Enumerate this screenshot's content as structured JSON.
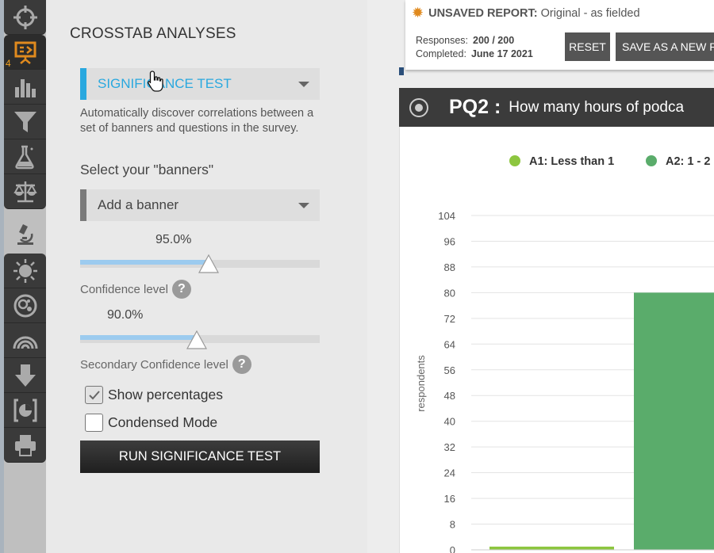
{
  "toolbar": {
    "items": [
      {
        "name": "target",
        "icon": "crosshair-icon"
      },
      {
        "name": "presentation",
        "icon": "presentation-icon",
        "badge": "4"
      },
      {
        "name": "charts",
        "icon": "bar-chart-icon"
      },
      {
        "name": "filter",
        "icon": "funnel-icon"
      },
      {
        "name": "lab",
        "icon": "flask-icon"
      },
      {
        "name": "weighting",
        "icon": "scales-icon"
      },
      {
        "name": "analysis",
        "icon": "microscope-icon"
      },
      {
        "name": "sun",
        "icon": "sun-icon"
      },
      {
        "name": "bubbles",
        "icon": "bubbles-icon"
      },
      {
        "name": "rainbow",
        "icon": "rainbow-icon"
      },
      {
        "name": "download",
        "icon": "download-arrow-icon"
      },
      {
        "name": "pie-export",
        "icon": "pie-bracket-icon"
      },
      {
        "name": "print",
        "icon": "printer-icon"
      }
    ]
  },
  "panel": {
    "title": "CROSSTAB ANALYSES",
    "analysis_select": "SIGNIFICANCE TEST",
    "description": "Automatically discover correlations between a set of banners and questions in the survey.",
    "banners_heading": "Select your \"banners\"",
    "banner_select": "Add a banner",
    "confidence": {
      "value": "95.0%",
      "fraction": 0.95,
      "label": "Confidence level"
    },
    "secondary_confidence": {
      "value": "90.0%",
      "fraction": 0.9,
      "label": "Secondary Confidence level"
    },
    "show_percentages": {
      "label": "Show percentages",
      "checked": true
    },
    "condensed_mode": {
      "label": "Condensed Mode",
      "checked": false
    },
    "run_button": "RUN SIGNIFICANCE TEST"
  },
  "report": {
    "status_label": "UNSAVED REPORT:",
    "status_value": "Original - as fielded",
    "responses_label": "Responses:",
    "responses_value": "200 / 200",
    "completed_label": "Completed:",
    "completed_value": "June 17 2021",
    "reset_button": "RESET",
    "save_as_button": "SAVE AS A NEW R"
  },
  "question": {
    "id": "PQ2 :",
    "text": "How many hours of podca"
  },
  "colors": {
    "accent": "#29a8df",
    "series_a1": "#8dc63f",
    "series_a2": "#5aac6b",
    "header_dark": "#3b3b3b",
    "orange": "#e08a1e"
  },
  "chart_data": {
    "type": "bar",
    "ylabel": "respondents",
    "ylim": [
      0,
      104
    ],
    "yticks": [
      0,
      8,
      16,
      24,
      32,
      40,
      48,
      56,
      64,
      72,
      80,
      88,
      96,
      104
    ],
    "series": [
      {
        "name": "A1: Less than 1",
        "value": 1,
        "color": "#8dc63f"
      },
      {
        "name": "A2: 1 - 2",
        "value": 80,
        "color": "#5aac6b"
      }
    ],
    "legend_position": "top",
    "grid": true
  }
}
